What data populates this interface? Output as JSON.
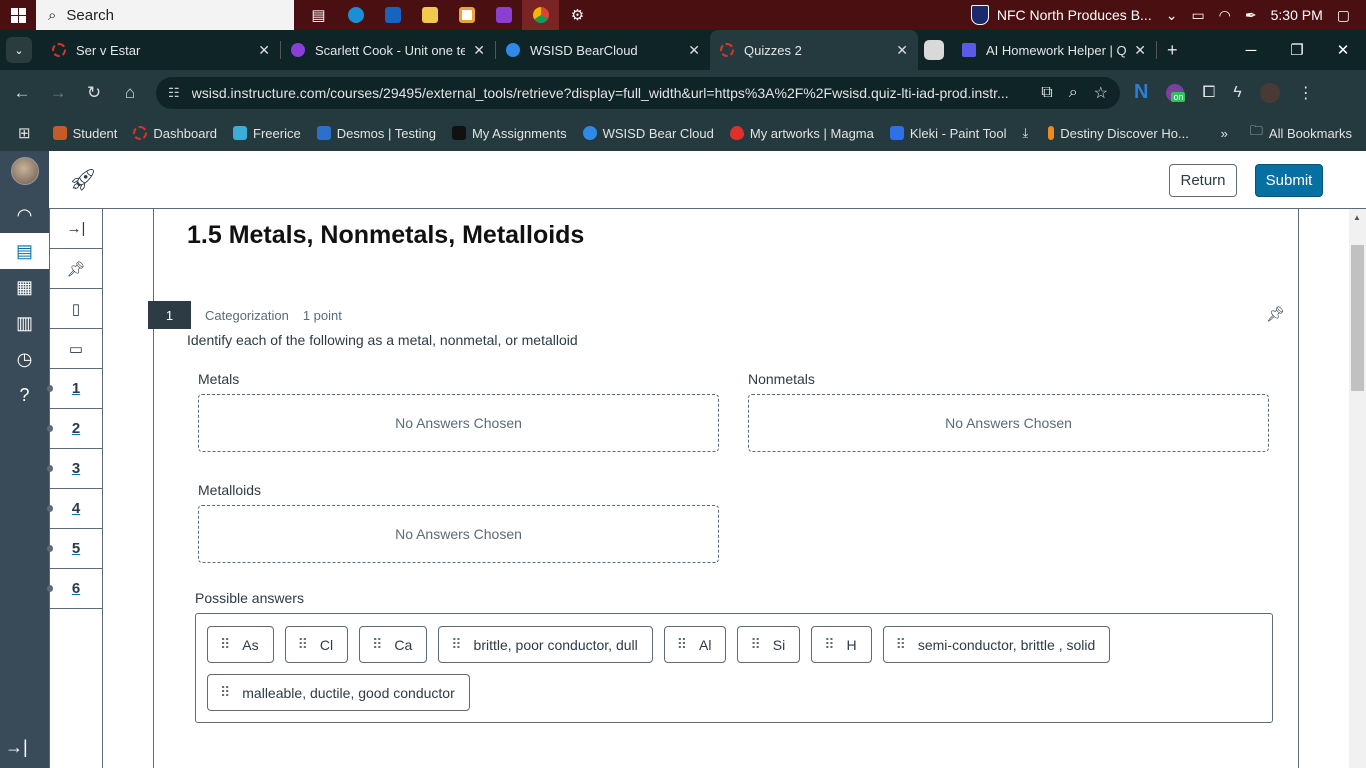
{
  "taskbar": {
    "search_placeholder": "Search",
    "news_headline": "NFC North Produces B...",
    "time": "5:30 PM"
  },
  "browser": {
    "tabs": [
      {
        "title": "Ser v Estar",
        "favicon_color": "#e0302b",
        "active": false
      },
      {
        "title": "Scarlett Cook - Unit one te",
        "favicon_color": "#8b3fd9",
        "active": false
      },
      {
        "title": "WSISD BearCloud",
        "favicon_color": "#2e8ae6",
        "active": false
      },
      {
        "title": "Quizzes 2",
        "favicon_color": "#e0302b",
        "active": true
      },
      {
        "title": "",
        "favicon_color": "#d9d9d9",
        "active": false
      },
      {
        "title": "AI Homework Helper | Quiz",
        "favicon_color": "#5a5ae6",
        "active": false
      }
    ],
    "new_tab": "+",
    "url": "wsisd.instructure.com/courses/29495/external_tools/retrieve?display=full_width&url=https%3A%2F%2Fwsisd.quiz-lti-iad-prod.instr...",
    "ext_badge": "on",
    "bookmarks": [
      {
        "label": "Student",
        "color": "#c85a2a"
      },
      {
        "label": "Dashboard",
        "color": "#e0302b"
      },
      {
        "label": "Freerice",
        "color": "#3aaed8"
      },
      {
        "label": "Desmos | Testing",
        "color": "#2d70c8"
      },
      {
        "label": "My Assignments",
        "color": "#222222"
      },
      {
        "label": "WSISD Bear Cloud",
        "color": "#2e8ae6"
      },
      {
        "label": "My artworks | Magma",
        "color": "#e0302b"
      },
      {
        "label": "Kleki - Paint Tool",
        "color": "#2d70e8"
      },
      {
        "label": "",
        "color": "transparent"
      },
      {
        "label": "Destiny Discover Ho...",
        "color": "#f08a1c"
      }
    ],
    "all_bookmarks": "All Bookmarks"
  },
  "quiz": {
    "return_label": "Return",
    "submit_label": "Submit",
    "title": "1.5 Metals, Nonmetals, Metalloids",
    "question_number": "1",
    "question_type": "Categorization",
    "points": "1 point",
    "prompt": "Identify each of the following as a metal, nonmetal, or metalloid",
    "categories": [
      {
        "label": "Metals",
        "empty_text": "No Answers Chosen"
      },
      {
        "label": "Nonmetals",
        "empty_text": "No Answers Chosen"
      },
      {
        "label": "Metalloids",
        "empty_text": "No Answers Chosen"
      }
    ],
    "possible_answers_label": "Possible answers",
    "answers": [
      "As",
      "Cl",
      "Ca",
      "brittle, poor conductor, dull",
      "Al",
      "Si",
      "H",
      "semi-conductor, brittle , solid",
      "malleable, ductile, good conductor"
    ],
    "question_nav": [
      "1",
      "2",
      "3",
      "4",
      "5",
      "6"
    ]
  },
  "colors": {
    "canvas_nav": "#394b58",
    "brand_blue": "#0770a3",
    "text_dark": "#2d3b45"
  }
}
